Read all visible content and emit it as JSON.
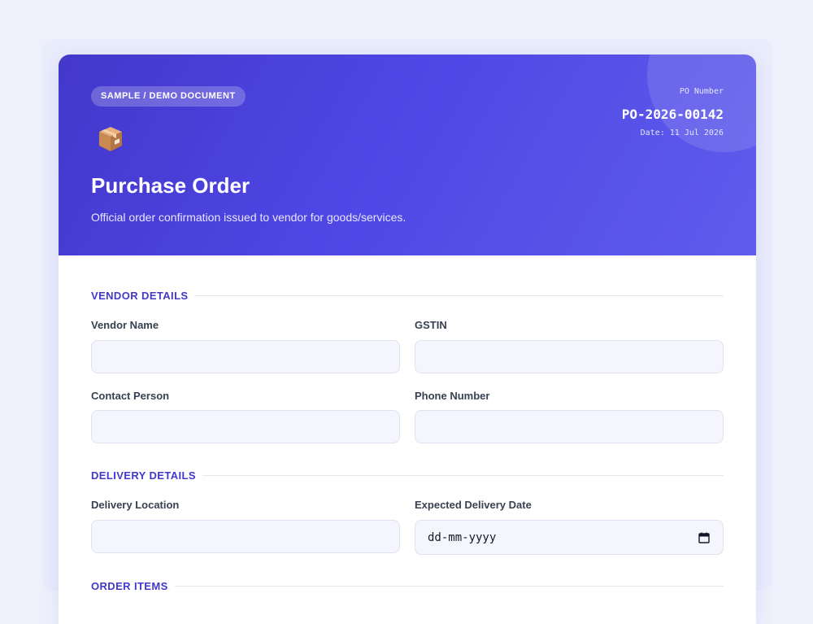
{
  "header": {
    "badge": "SAMPLE / DEMO DOCUMENT",
    "title": "Purchase Order",
    "subtitle": "Official order confirmation issued to vendor for goods/services.",
    "po_label": "PO Number",
    "po_number": "PO-2026-00142",
    "po_date": "Date: 11 Jul 2026",
    "icon": "package-icon"
  },
  "sections": {
    "vendor": {
      "title": "VENDOR DETAILS",
      "vendor_name_label": "Vendor Name",
      "vendor_name_value": "",
      "gstin_label": "GSTIN",
      "gstin_value": "",
      "contact_label": "Contact Person",
      "contact_value": "",
      "phone_label": "Phone Number",
      "phone_value": ""
    },
    "delivery": {
      "title": "DELIVERY DETAILS",
      "location_label": "Delivery Location",
      "location_value": "",
      "date_label": "Expected Delivery Date",
      "date_placeholder": "dd-mm-yyyy"
    },
    "items": {
      "title": "ORDER ITEMS"
    }
  },
  "colors": {
    "accent": "#4338ca",
    "header_gradient_start": "#4338ca",
    "header_gradient_end": "#5f5cec",
    "page_background": "#eef1fb",
    "input_background": "#f5f6fd"
  }
}
